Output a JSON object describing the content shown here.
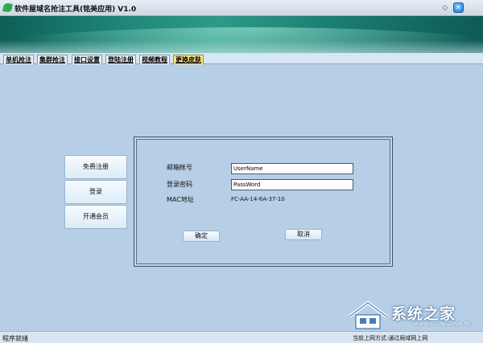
{
  "window": {
    "title": "软件屋域名抢注工具(铭美应用)",
    "version": "V1.0",
    "icons": {
      "app": "leaf-icon",
      "restore": "restore-icon",
      "close": "close-icon"
    }
  },
  "tabs": [
    {
      "label": "单机抢注",
      "active": false
    },
    {
      "label": "集群抢注",
      "active": false
    },
    {
      "label": "接口设置",
      "active": false
    },
    {
      "label": "登陆注册",
      "active": false
    },
    {
      "label": "视频教程",
      "active": false
    },
    {
      "label": "更换皮肤",
      "active": true
    }
  ],
  "side_buttons": [
    {
      "label": "免费注册"
    },
    {
      "label": "登录"
    },
    {
      "label": "开通会员"
    }
  ],
  "form": {
    "email_label": "邮箱帐号",
    "email_value": "UserName",
    "password_label": "登录密码",
    "password_value": "PassWord",
    "mac_label": "MAC地址",
    "mac_value": "FC-AA-14-6A-37-10",
    "confirm_label": "确定",
    "cancel_label": "取消"
  },
  "status": {
    "left": "程序就绪",
    "right": "当前上网方式:通过局域网上网"
  },
  "watermark": {
    "text": "系统之家",
    "url": "WWW.XITONGZHIJIA.NET"
  },
  "colors": {
    "accent_tab": "#ffe680",
    "background": "#b6cfe6",
    "banner": "#1d8678"
  }
}
